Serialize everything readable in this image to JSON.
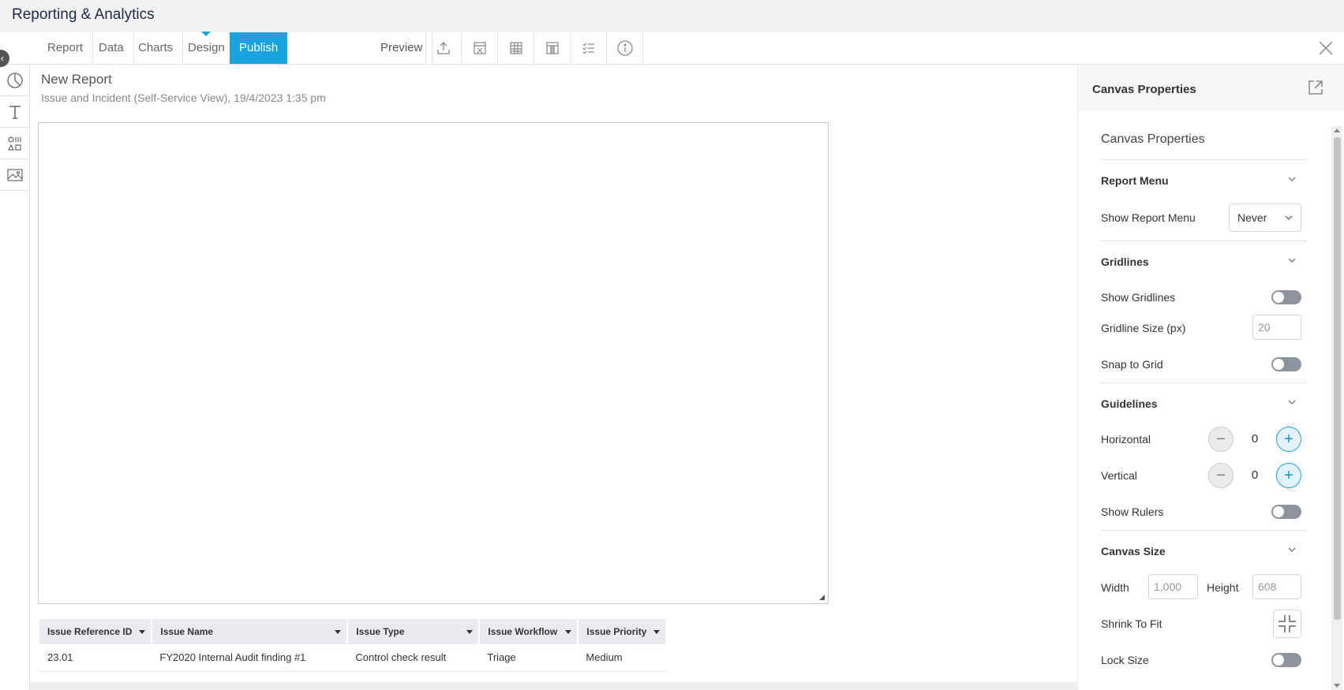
{
  "app": {
    "title": "Reporting & Analytics"
  },
  "toolbar": {
    "tabs": [
      "Report",
      "Data",
      "Charts",
      "Design",
      "Publish"
    ],
    "active_tab": "Publish",
    "preview_label": "Preview",
    "tools": [
      "export-icon",
      "excel-icon",
      "table-icon",
      "column-icon",
      "list-icon",
      "info-icon"
    ]
  },
  "rail": {
    "items": [
      "chart-icon",
      "text-icon",
      "shapes-icon",
      "image-icon"
    ]
  },
  "report": {
    "title": "New Report",
    "subtitle": "Issue and Incident (Self-Service View), 19/4/2023 1:35 pm"
  },
  "table": {
    "columns": [
      "Issue Reference ID",
      "Issue Name",
      "Issue Type",
      "Issue Workflow",
      "Issue Priority"
    ],
    "rows": [
      [
        "23.01",
        "FY2020 Internal Audit finding #1",
        "Control check result",
        "Triage",
        "Medium"
      ]
    ]
  },
  "panel": {
    "header": "Canvas Properties",
    "body_title": "Canvas Properties",
    "report_menu": {
      "label": "Report Menu",
      "show_label": "Show Report Menu",
      "show_value": "Never"
    },
    "gridlines": {
      "label": "Gridlines",
      "show_label": "Show Gridlines",
      "show_on": false,
      "size_label": "Gridline Size (px)",
      "size_value": "20",
      "snap_label": "Snap to Grid",
      "snap_on": false
    },
    "guidelines": {
      "label": "Guidelines",
      "horizontal_label": "Horizontal",
      "horizontal_value": "0",
      "vertical_label": "Vertical",
      "vertical_value": "0",
      "rulers_label": "Show Rulers",
      "rulers_on": false
    },
    "canvas_size": {
      "label": "Canvas Size",
      "width_label": "Width",
      "width_value": "1,000",
      "height_label": "Height",
      "height_value": "608",
      "shrink_label": "Shrink To Fit",
      "lock_label": "Lock Size",
      "lock_on": false
    }
  },
  "colors": {
    "accent": "#1aa3dd",
    "toggle_off": "#8e949e",
    "header_bg": "#e9ebee"
  }
}
